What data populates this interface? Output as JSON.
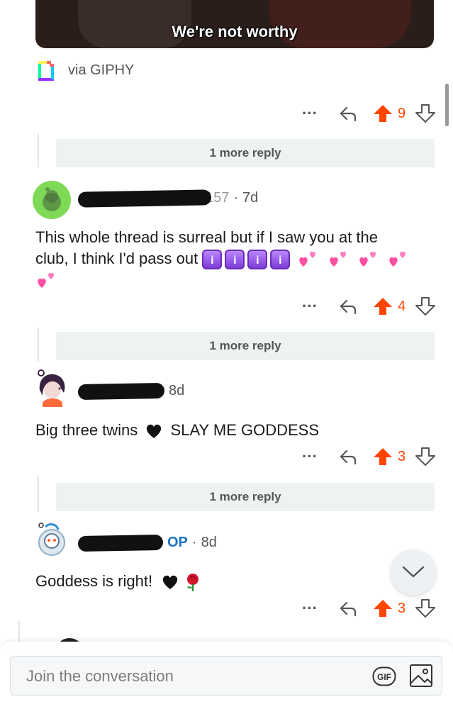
{
  "gif": {
    "caption": "We're not worthy"
  },
  "giphy": {
    "label": "via GIPHY"
  },
  "comments": [
    {
      "id": "c0",
      "actions": {
        "upvotes": "9"
      },
      "more_reply": "1 more reply"
    },
    {
      "id": "c1",
      "username_partial": "157",
      "time": "7d",
      "text_line1": "This whole thread is surreal but if I saw you at the",
      "text_line2": "club, I think I'd pass out",
      "actions": {
        "upvotes": "4"
      },
      "more_reply": "1 more reply"
    },
    {
      "id": "c2",
      "time": "8d",
      "text_before": "Big three twins",
      "text_after": "SLAY ME GODDESS",
      "actions": {
        "upvotes": "3"
      },
      "more_reply": "1 more reply"
    },
    {
      "id": "c3",
      "op_badge": "OP",
      "time": "8d",
      "text": "Goddess is right!",
      "actions": {
        "upvotes": "3"
      }
    }
  ],
  "composer": {
    "placeholder": "Join the conversation",
    "gif_label": "GIF"
  },
  "colors": {
    "upvote": "#ff4500",
    "op": "#1a73c8",
    "more_reply_bg": "#eef2f3"
  },
  "icons": [
    "more-icon",
    "reply-icon",
    "upvote-arrow-icon",
    "downvote-arrow-icon",
    "chevron-down-icon",
    "gif-icon",
    "image-icon",
    "giphy-logo-icon"
  ]
}
